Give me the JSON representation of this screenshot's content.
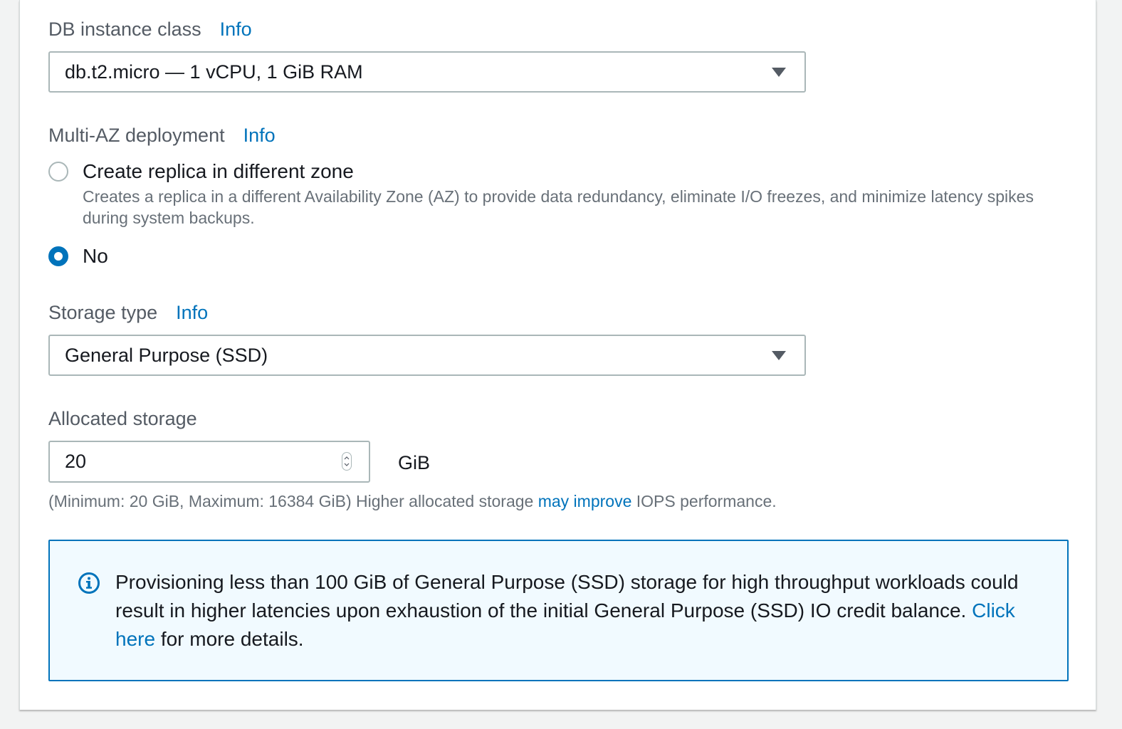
{
  "db_instance_class": {
    "label": "DB instance class",
    "info": "Info",
    "selected": "db.t2.micro — 1 vCPU, 1 GiB RAM"
  },
  "multi_az": {
    "label": "Multi-AZ deployment",
    "info": "Info",
    "options": [
      {
        "label": "Create replica in different zone",
        "description": "Creates a replica in a different Availability Zone (AZ) to provide data redundancy, eliminate I/O freezes, and minimize latency spikes during system backups.",
        "selected": false
      },
      {
        "label": "No",
        "selected": true
      }
    ]
  },
  "storage_type": {
    "label": "Storage type",
    "info": "Info",
    "selected": "General Purpose (SSD)"
  },
  "allocated_storage": {
    "label": "Allocated storage",
    "value": "20",
    "unit": "GiB",
    "constraint_prefix": "(Minimum: 20 GiB, Maximum: 16384 GiB) Higher allocated storage ",
    "constraint_link": "may improve",
    "constraint_suffix": " IOPS performance."
  },
  "alert": {
    "icon": "info-circle-icon",
    "text": "Provisioning less than 100 GiB of General Purpose (SSD) storage for high throughput workloads could result in higher latencies upon exhaustion of the initial General Purpose (SSD) IO credit balance. ",
    "link": "Click here",
    "suffix": " for more details."
  },
  "colors": {
    "accent": "#0073bb",
    "alert_bg": "#f1faff",
    "label": "#545b64",
    "muted": "#687078",
    "border": "#aab7b8"
  }
}
